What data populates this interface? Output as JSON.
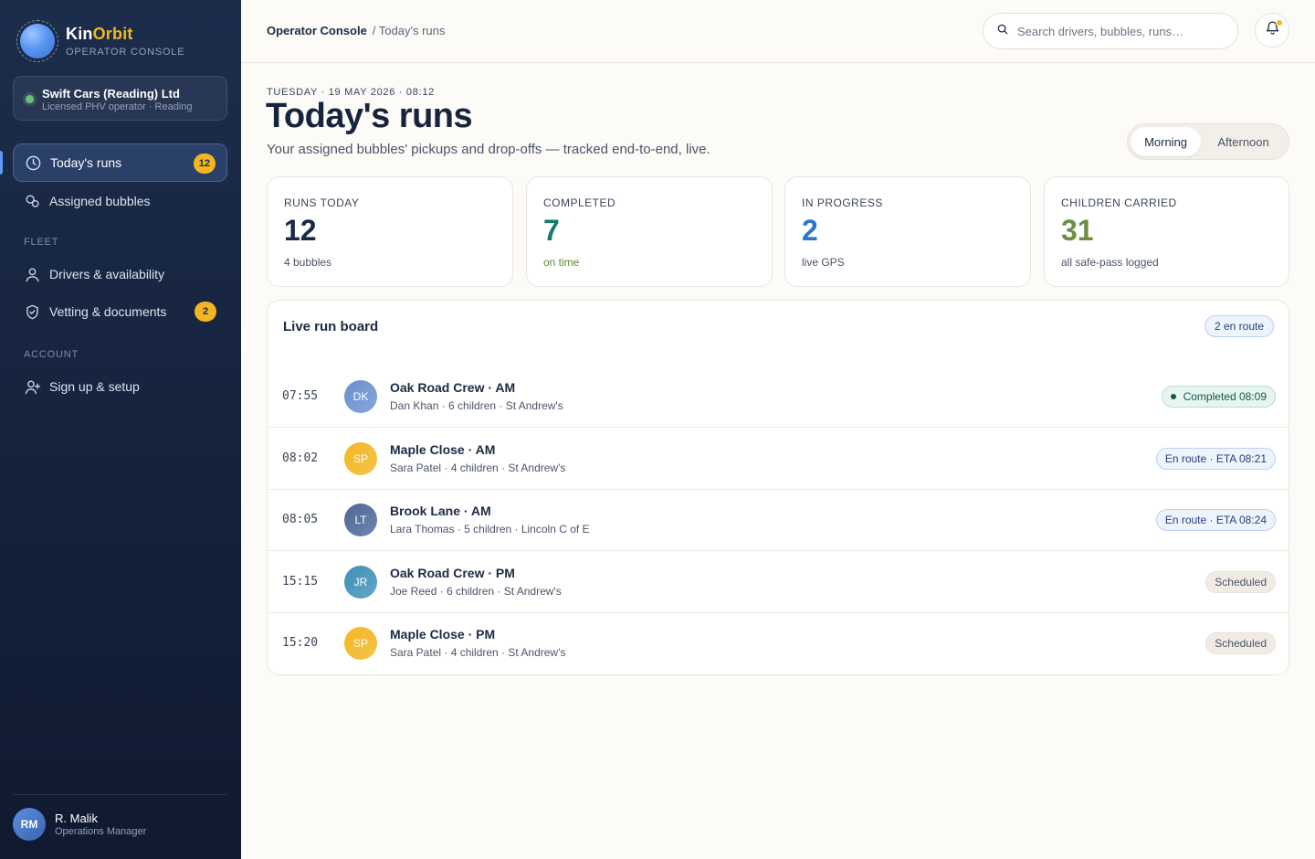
{
  "brand": {
    "name_part1": "Kin",
    "name_part2": "Orbit",
    "subtitle": "OPERATOR CONSOLE"
  },
  "org": {
    "name": "Swift Cars (Reading) Ltd",
    "subtitle": "Licensed PHV operator · Reading"
  },
  "nav": {
    "todays_runs": {
      "label": "Today's runs",
      "badge": "12"
    },
    "assigned_bubbles": {
      "label": "Assigned bubbles"
    },
    "fleet_section": "FLEET",
    "drivers": {
      "label": "Drivers & availability"
    },
    "vetting": {
      "label": "Vetting & documents",
      "badge": "2"
    },
    "account_section": "ACCOUNT",
    "signup": {
      "label": "Sign up & setup"
    }
  },
  "user": {
    "initials": "RM",
    "name": "R. Malik",
    "role": "Operations Manager"
  },
  "topbar": {
    "breadcrumb_root": "Operator Console",
    "breadcrumb_current": "/ Today's runs",
    "search_placeholder": "Search drivers, bubbles, runs…"
  },
  "header": {
    "dateline": "TUESDAY · 19 MAY 2026 · 08:12",
    "title": "Today's runs",
    "subtitle": "Your assigned bubbles' pickups and drop-offs — tracked end-to-end, live.",
    "segments": [
      "Morning",
      "Afternoon"
    ],
    "selected_segment": "Morning"
  },
  "stats": [
    {
      "label": "RUNS TODAY",
      "value": "12",
      "note": "4 bubbles",
      "color": "#1b2a44",
      "note_color": "#4a5468"
    },
    {
      "label": "COMPLETED",
      "value": "7",
      "note": "on time",
      "color": "#117a6e",
      "note_color": "#5f8a3a"
    },
    {
      "label": "IN PROGRESS",
      "value": "2",
      "note": "live GPS",
      "color": "#2e74c9",
      "note_color": "#4a5468"
    },
    {
      "label": "CHILDREN CARRIED",
      "value": "31",
      "note": "all safe-pass logged",
      "color": "#6c8f43",
      "note_color": "#4a5468"
    }
  ],
  "board": {
    "title": "Live run board",
    "pill": "2 en route",
    "runs": [
      {
        "time": "07:55",
        "initials": "DK",
        "name": "Oak Road Crew · AM",
        "detail": "Dan Khan · 6 children · St Andrew's",
        "status": "Completed 08:09",
        "status_type": "completed",
        "avatar_color": "#6a8fd0"
      },
      {
        "time": "08:02",
        "initials": "SP",
        "name": "Maple Close · AM",
        "detail": "Sara Patel · 4 children · St Andrew's",
        "status": "En route · ETA 08:21",
        "status_type": "enroute",
        "avatar_color": "#f3b521"
      },
      {
        "time": "08:05",
        "initials": "LT",
        "name": "Brook Lane · AM",
        "detail": "Lara Thomas · 5 children · Lincoln C of E",
        "status": "En route · ETA 08:24",
        "status_type": "enroute",
        "avatar_color": "#4d6797"
      },
      {
        "time": "15:15",
        "initials": "JR",
        "name": "Oak Road Crew · PM",
        "detail": "Joe Reed · 6 children · St Andrew's",
        "status": "Scheduled",
        "status_type": "scheduled",
        "avatar_color": "#3f8fb8"
      },
      {
        "time": "15:20",
        "initials": "SP",
        "name": "Maple Close · PM",
        "detail": "Sara Patel · 4 children · St Andrew's",
        "status": "Scheduled",
        "status_type": "scheduled",
        "avatar_color": "#f3b521"
      }
    ]
  }
}
